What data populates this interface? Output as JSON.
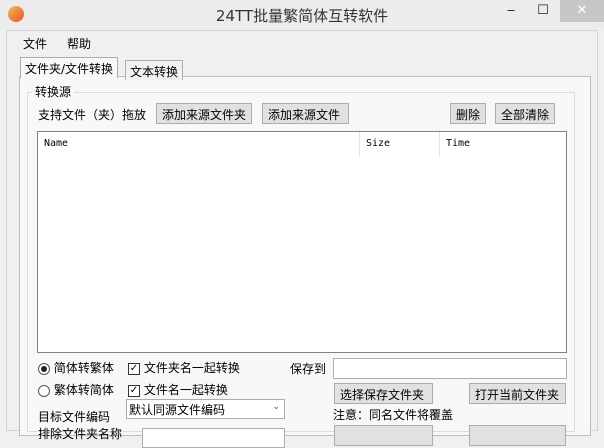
{
  "window": {
    "title": "24TT批量繁简体互转软件",
    "minimize": "‒",
    "maximize": "☐",
    "close": "✕"
  },
  "menu": [
    "文件",
    "帮助"
  ],
  "tabs": [
    "文件夹/文件转换",
    "文本转换"
  ],
  "source": {
    "group_label": "转换源",
    "drag_hint": "支持文件（夹）拖放",
    "add_folder": "添加来源文件夹",
    "add_file": "添加来源文件",
    "delete": "删除",
    "clear_all": "全部清除"
  },
  "table": {
    "columns": [
      "Name",
      "Size",
      "Time"
    ],
    "rows": []
  },
  "options": {
    "radio_s2t": "简体转繁体",
    "radio_t2s": "繁体转简体",
    "chk_folder_name": "文件夹名一起转换",
    "chk_file_name": "文件名一起转换",
    "encoding_label": "目标文件编码",
    "encoding_value": "默认同源文件编码",
    "exclude_label": "排除文件夹名称"
  },
  "save": {
    "label": "保存到",
    "path": "",
    "choose": "选择保存文件夹",
    "open": "打开当前文件夹",
    "note": "注意：同名文件将覆盖"
  }
}
